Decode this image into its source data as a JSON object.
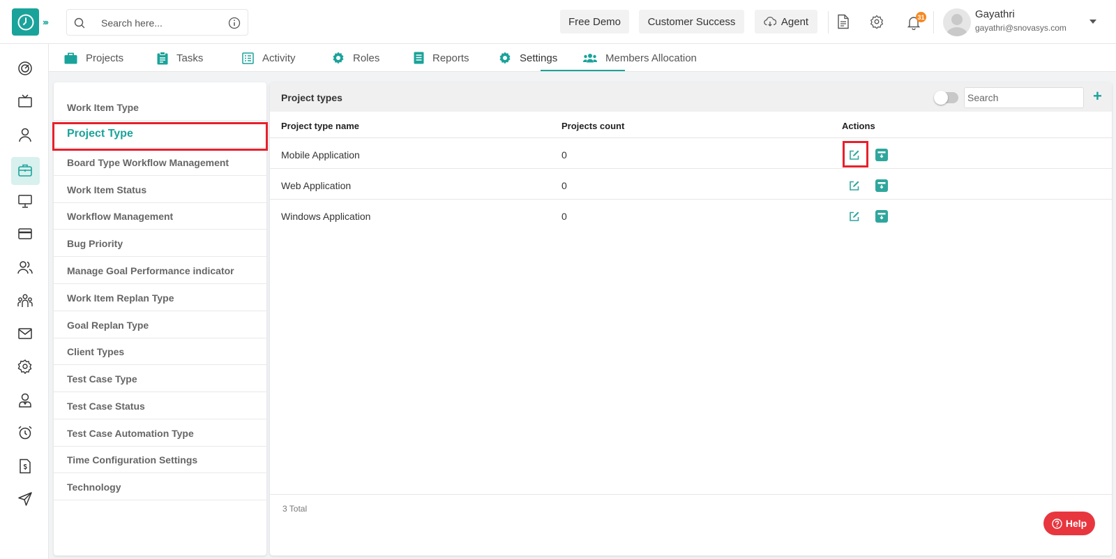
{
  "search": {
    "placeholder": "Search here..."
  },
  "toolbar": {
    "free_demo": "Free Demo",
    "customer_success": "Customer Success",
    "agent": "Agent",
    "notification_count": "31"
  },
  "user": {
    "name": "Gayathri",
    "email": "gayathri@snovasys.com"
  },
  "tabs": [
    {
      "label": "Projects",
      "icon": "briefcase-icon"
    },
    {
      "label": "Tasks",
      "icon": "clipboard-icon"
    },
    {
      "label": "Activity",
      "icon": "list-icon"
    },
    {
      "label": "Roles",
      "icon": "gear-icon"
    },
    {
      "label": "Reports",
      "icon": "report-icon"
    },
    {
      "label": "Settings",
      "icon": "gear-icon",
      "active": true
    },
    {
      "label": "Members Allocation",
      "icon": "users-icon"
    }
  ],
  "settings_menu": [
    "Work Item Type",
    "Project Type",
    "Board Type Workflow Management",
    "Work Item Status",
    "Workflow Management",
    "Bug Priority",
    "Manage Goal Performance indicator",
    "Work Item Replan Type",
    "Goal Replan Type",
    "Client Types",
    "Test Case Type",
    "Test Case Status",
    "Test Case Automation Type",
    "Time Configuration Settings",
    "Technology"
  ],
  "selected_setting": "Project Type",
  "panel": {
    "title": "Project types",
    "search_placeholder": "Search",
    "columns": [
      "Project type name",
      "Projects count",
      "Actions"
    ],
    "rows": [
      {
        "name": "Mobile Application",
        "count": "0"
      },
      {
        "name": "Web Application",
        "count": "0"
      },
      {
        "name": "Windows Application",
        "count": "0"
      }
    ],
    "total": "3 Total"
  },
  "help": {
    "label": "Help"
  },
  "colors": {
    "accent": "#1aa39a",
    "highlight": "#e8202c",
    "help": "#e8363f",
    "badge": "#f58a23"
  }
}
